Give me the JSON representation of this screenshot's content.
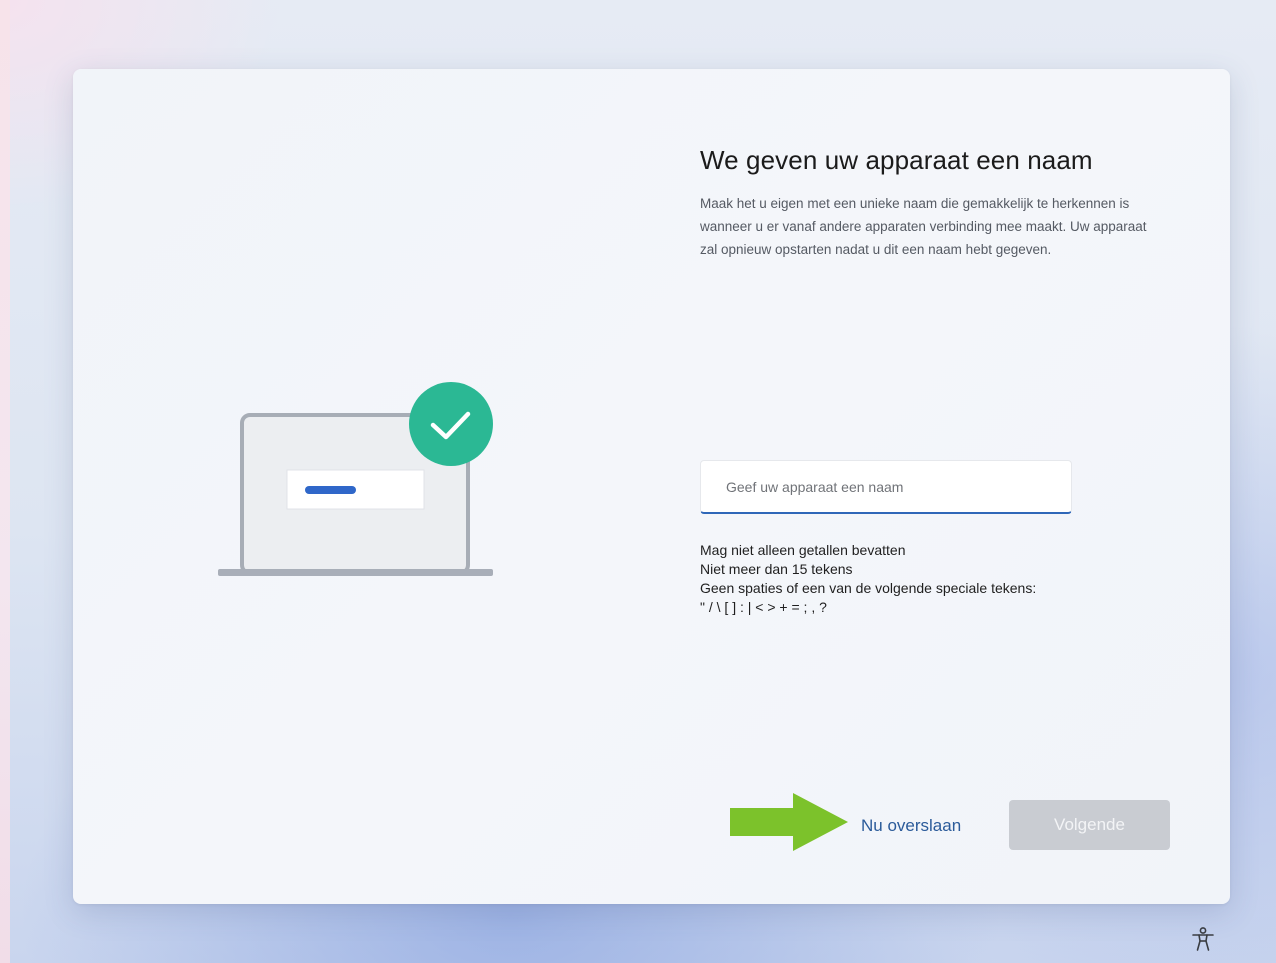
{
  "page": {
    "title": "We geven uw apparaat een naam",
    "description": "Maak het u eigen met een unieke naam die gemakkelijk te herkennen is wanneer u er vanaf andere apparaten verbinding mee maakt. Uw apparaat zal opnieuw opstarten nadat u dit een naam hebt gegeven."
  },
  "name_field": {
    "placeholder": "Geef uw apparaat een naam",
    "value": ""
  },
  "rules": [
    "Mag niet alleen getallen bevatten",
    "Niet meer dan 15 tekens",
    "Geen spaties of een van de volgende speciale tekens:",
    "\" / \\ [ ] : | < > + = ; , ?"
  ],
  "footer": {
    "skip_label": "Nu overslaan",
    "next_label": "Volgende",
    "next_enabled": false
  },
  "icons": {
    "illustration": "laptop-with-checkmark-icon",
    "arrow": "arrow-right-icon",
    "accessibility": "accessibility-icon"
  },
  "colors": {
    "accent": "#2f67b8",
    "check_badge": "#2bb894",
    "arrow": "#7cc22b",
    "disabled_button": "#c9ccd2",
    "link": "#2b5b9a"
  }
}
